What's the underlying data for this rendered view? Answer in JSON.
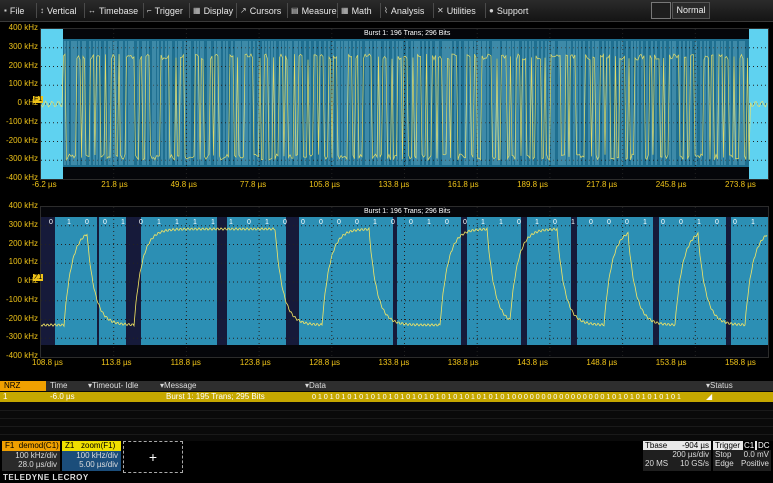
{
  "menu": {
    "items": [
      {
        "label": "File",
        "icon": "file-icon",
        "glyph": "▪"
      },
      {
        "label": "Vertical",
        "icon": "vertical-icon",
        "glyph": "↕"
      },
      {
        "label": "Timebase",
        "icon": "timebase-icon",
        "glyph": "↔"
      },
      {
        "label": "Trigger",
        "icon": "trigger-icon",
        "glyph": "⌐"
      },
      {
        "label": "Display",
        "icon": "display-icon",
        "glyph": "▦"
      },
      {
        "label": "Cursors",
        "icon": "cursors-icon",
        "glyph": "↗"
      },
      {
        "label": "Measure",
        "icon": "measure-icon",
        "glyph": "▤"
      },
      {
        "label": "Math",
        "icon": "math-icon",
        "glyph": "▦"
      },
      {
        "label": "Analysis",
        "icon": "analysis-icon",
        "glyph": "⌇"
      },
      {
        "label": "Utilities",
        "icon": "utilities-icon",
        "glyph": "✕"
      },
      {
        "label": "Support",
        "icon": "support-icon",
        "glyph": "●"
      }
    ],
    "mode": "Normal"
  },
  "top_plot": {
    "burst_label": "Burst 1: 196 Trans; 296 Bits",
    "y_labels": [
      "400 kHz",
      "300 kHz",
      "200 kHz",
      "100 kHz",
      "0 kHz",
      "-100 kHz",
      "-200 kHz",
      "-300 kHz",
      "-400 kHz"
    ],
    "x_labels": [
      "-6.2 µs",
      "21.8 µs",
      "49.8 µs",
      "77.8 µs",
      "105.8 µs",
      "133.8 µs",
      "161.8 µs",
      "189.8 µs",
      "217.8 µs",
      "245.8 µs",
      "273.8 µs"
    ],
    "marker": "F1"
  },
  "zoom_plot": {
    "burst_label": "Burst 1: 196 Trans; 296 Bits",
    "y_labels": [
      "400 kHz",
      "300 kHz",
      "200 kHz",
      "100 kHz",
      "0 kHz",
      "-100 kHz",
      "-200 kHz",
      "-300 kHz",
      "-400 kHz"
    ],
    "x_labels": [
      "108.8 µs",
      "113.8 µs",
      "118.8 µs",
      "123.8 µs",
      "128.8 µs",
      "133.8 µs",
      "138.8 µs",
      "143.8 µs",
      "148.8 µs",
      "153.8 µs",
      "158.8 µs"
    ],
    "marker": "Z1",
    "bits": [
      "0",
      "1",
      "0",
      "0",
      "1",
      "0",
      "1",
      "1",
      "1",
      "1",
      "1",
      "0",
      "1",
      "0",
      "0",
      "0",
      "0",
      "0",
      "1",
      "0",
      "0",
      "1",
      "0",
      "0",
      "1",
      "1",
      "0",
      "1",
      "0",
      "1",
      "0",
      "0",
      "0",
      "1",
      "0",
      "0",
      "1",
      "0",
      "0",
      "1"
    ]
  },
  "table": {
    "headers": {
      "nrz": "NRZ",
      "time": "Time",
      "timeout": "Timeout- Idle",
      "message": "Message",
      "data": "Data",
      "status": "Status"
    },
    "row": {
      "index": "1",
      "time": "-6.0 µs",
      "message": "Burst 1: 195 Trans; 295 Bits",
      "data": "0 1 0 1 0 1 0 1 0 1 0 1 0 1 0 1 0 1 0 1 0 1 0 1 0 1 0 1 0 1 0 1 0 1 0 0 0 0 0 0 0 0 0 0 0 0 0 0 0 0 1 0 1 0 1 0 1 0 1 0 1 0 1",
      "status": "◢"
    }
  },
  "traces": {
    "f1": {
      "name": "F1",
      "label": "demod(C1)",
      "vdiv": "100 kHz/div",
      "tdiv": "28.0 µs/div"
    },
    "z1": {
      "name": "Z1",
      "label": "zoom(F1)",
      "vdiv": "100 kHz/div",
      "tdiv": "5.00 µs/div"
    },
    "add": "+"
  },
  "timebase": {
    "title": "Tbase",
    "offset": "-904 µs",
    "tdiv": "200 µs/div",
    "samples": "20 MS",
    "rate": "10 GS/s"
  },
  "trigger": {
    "title": "Trigger",
    "ch": "C1",
    "coupling": "DC",
    "mode": "Stop",
    "level": "0.0 mV",
    "type": "Edge",
    "slope": "Positive"
  },
  "brand": "TELEDYNE LECROY",
  "colors": {
    "trace": "#f5e663",
    "accent": "#f0c419",
    "band": "#3ab3d6",
    "cursor": "#8fe3ff"
  }
}
